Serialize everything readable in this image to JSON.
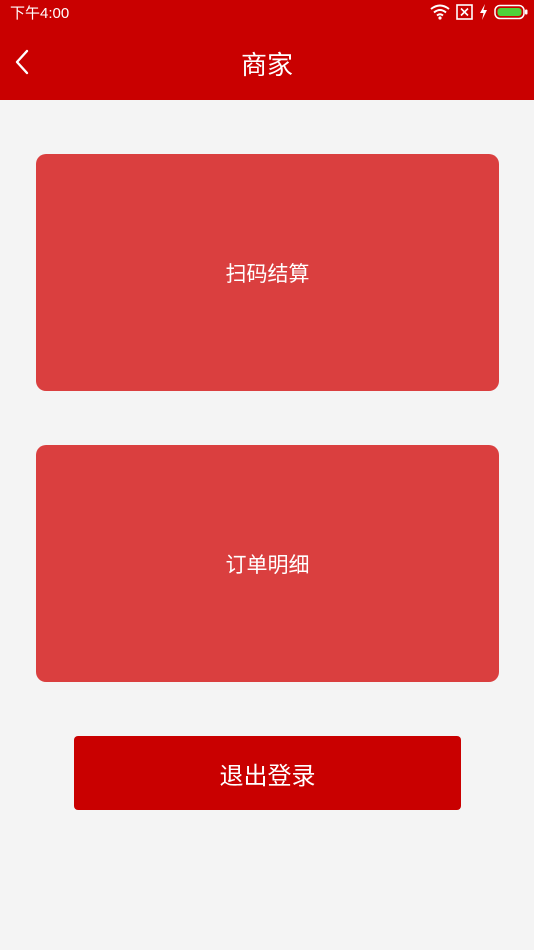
{
  "status_bar": {
    "time": "下午4:00",
    "icons": [
      "wifi-icon",
      "sim-x-icon",
      "charging-icon",
      "battery-icon"
    ]
  },
  "header": {
    "title": "商家",
    "back_icon": "chevron-left-icon",
    "background_color": "#c90000"
  },
  "menu": {
    "scan_checkout_label": "扫码结算",
    "order_details_label": "订单明细",
    "card_color": "#da3f3f"
  },
  "logout": {
    "label": "退出登录",
    "color": "#c90000"
  }
}
